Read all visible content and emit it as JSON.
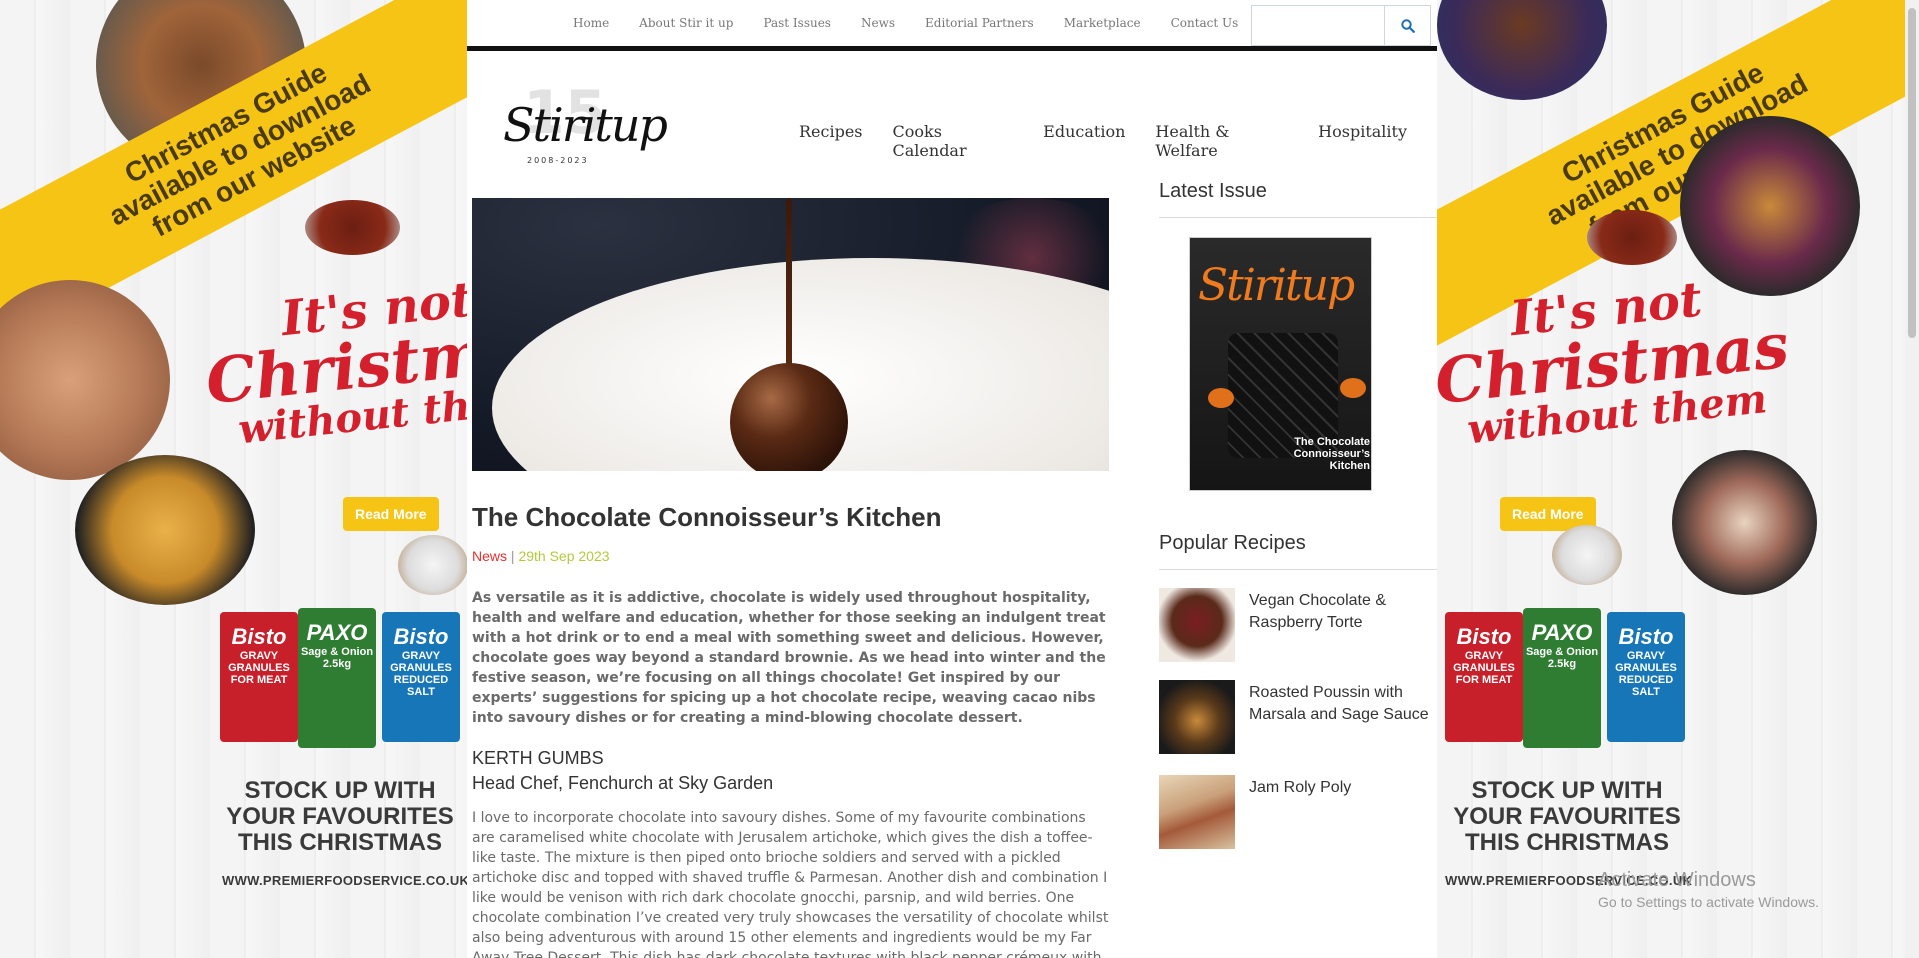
{
  "topnav": {
    "links": [
      "Home",
      "About Stir it up",
      "Past Issues",
      "News",
      "Editorial Partners",
      "Marketplace",
      "Contact Us"
    ],
    "search_placeholder": "",
    "search_icon": "search-icon"
  },
  "logo": {
    "anniversary": "15",
    "wordmark": "Stiritup",
    "years": "2008-2023"
  },
  "mainnav": [
    "Recipes",
    "Cooks Calendar",
    "Education",
    "Health & Welfare",
    "Hospitality"
  ],
  "article": {
    "title": "The Chocolate Connoisseur’s Kitchen",
    "category": "News",
    "separator": " | ",
    "date": "29th Sep 2023",
    "lead": "As versatile as it is addictive, chocolate is widely used throughout hospitality, health and welfare and education, whether for those seeking an indulgent treat with a hot drink or to end a meal with something sweet and delicious. However, chocolate goes way beyond a standard brownie. As we head into winter and the festive season, we’re focusing on all things chocolate! Get inspired by our experts’ suggestions for spicing up a hot chocolate recipe, weaving cacao nibs into savoury dishes or for creating a mind-blowing chocolate dessert.",
    "chef_name": "KERTH GUMBS",
    "chef_role": "Head Chef, Fenchurch at Sky Garden",
    "body": "I love to incorporate chocolate into savoury dishes. Some of my favourite combinations are caramelised white chocolate with Jerusalem artichoke, which gives the dish a toffee-like taste. The mixture is then piped onto brioche soldiers and served with a pickled artichoke disc and topped with shaved truffle & Parmesan. Another dish and combination I like would be venison with rich dark chocolate gnocchi, parsnip, and wild berries. One chocolate combination I’ve created very truly showcases the versatility of chocolate whilst also being adventurous with around 15 other elements and ingredients would be my Far Away Tree Dessert. This dish has dark chocolate textures with black pepper crémeux with burnt blackberry, kasha buckwheat and sea buckthorn"
  },
  "sidebar": {
    "latest_issue_heading": "Latest Issue",
    "cover": {
      "masthead": "Stiritup",
      "headline": "The Chocolate Connoisseur’s Kitchen"
    },
    "popular_heading": "Popular Recipes",
    "recipes": [
      {
        "title": "Vegan Chocolate & Raspberry Torte"
      },
      {
        "title": "Roasted Poussin with Marsala and Sage Sauce"
      },
      {
        "title": "Jam Roly Poly"
      }
    ]
  },
  "ad": {
    "ribbon_lines": [
      "Christmas Guide",
      "available to download",
      "from our website"
    ],
    "headline_lines": [
      "It's not",
      "Christmas",
      "without them"
    ],
    "read_more": "Read More",
    "packs": [
      {
        "brand": "Bisto",
        "label": "GRAVY GRANULES FOR MEAT",
        "color": "#c8202a"
      },
      {
        "brand": "PAXO",
        "label": "Sage & Onion 2.5kg",
        "color": "#2f7d32"
      },
      {
        "brand": "Bisto",
        "label": "GRAVY GRANULES REDUCED SALT",
        "color": "#1676b8"
      }
    ],
    "stock_lines": [
      "STOCK UP WITH",
      "YOUR FAVOURITES",
      "THIS CHRISTMAS"
    ],
    "url": "WWW.PREMIERFOODSERVICE.CO.UK"
  },
  "watermark": {
    "line1": "Activate Windows",
    "line2": "Go to Settings to activate Windows."
  }
}
